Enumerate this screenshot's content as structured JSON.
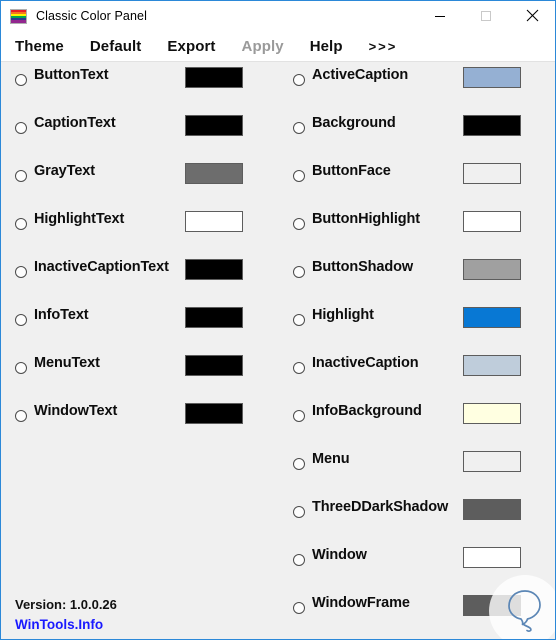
{
  "window": {
    "title": "Classic Color Panel",
    "icon": "rainbow-icon",
    "border_color": "#2b88d8",
    "background": "#f0f0f0",
    "controls": [
      {
        "name": "minimize",
        "glyph": "minimize-icon"
      },
      {
        "name": "maximize",
        "glyph": "maximize-icon"
      },
      {
        "name": "close",
        "glyph": "close-icon"
      }
    ]
  },
  "menu": {
    "items": [
      {
        "label": "Theme",
        "disabled": false
      },
      {
        "label": "Default",
        "disabled": false
      },
      {
        "label": "Export",
        "disabled": false
      },
      {
        "label": "Apply",
        "disabled": true
      },
      {
        "label": "Help",
        "disabled": false
      },
      {
        "label": ">>>",
        "disabled": false
      }
    ]
  },
  "left_column": [
    {
      "label": "ButtonText",
      "color": "#000000"
    },
    {
      "label": "CaptionText",
      "color": "#000000"
    },
    {
      "label": "GrayText",
      "color": "#6d6d6d"
    },
    {
      "label": "HighlightText",
      "color": "#ffffff"
    },
    {
      "label": "InactiveCaptionText",
      "color": "#000000"
    },
    {
      "label": "InfoText",
      "color": "#000000"
    },
    {
      "label": "MenuText",
      "color": "#000000"
    },
    {
      "label": "WindowText",
      "color": "#000000"
    }
  ],
  "right_column": [
    {
      "label": "ActiveCaption",
      "color": "#95b0d3"
    },
    {
      "label": "Background",
      "color": "#000000"
    },
    {
      "label": "ButtonFace",
      "color": "#f0f0f0"
    },
    {
      "label": "ButtonHighlight",
      "color": "#ffffff"
    },
    {
      "label": "ButtonShadow",
      "color": "#a0a0a0"
    },
    {
      "label": "Highlight",
      "color": "#0878d4"
    },
    {
      "label": "InactiveCaption",
      "color": "#bfcddb"
    },
    {
      "label": "InfoBackground",
      "color": "#ffffe1"
    },
    {
      "label": "Menu",
      "color": "#f0f0f0"
    },
    {
      "label": "ThreeDDarkShadow",
      "color": "#5d5d5d"
    },
    {
      "label": "Window",
      "color": "#ffffff"
    },
    {
      "label": "WindowFrame",
      "color": "#5d5d5d"
    }
  ],
  "footer": {
    "version": "Version: 1.0.0.26",
    "link": "WinTools.Info",
    "link_color": "#1919ff"
  },
  "watermark": {
    "name": "balloon-logo-watermark",
    "color": "#5b86b5"
  }
}
